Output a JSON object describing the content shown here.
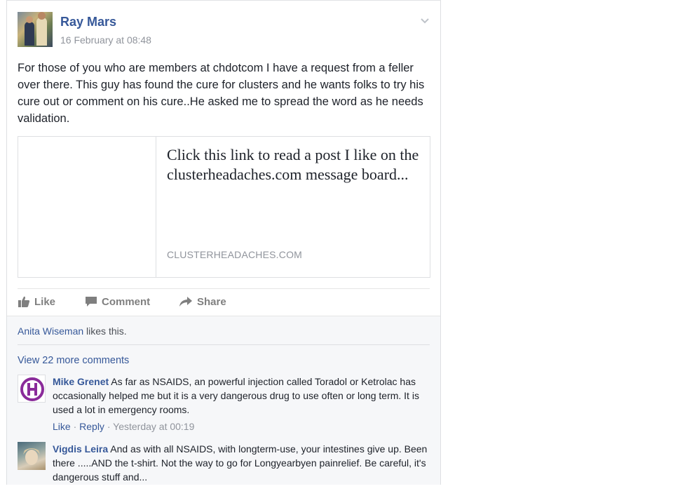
{
  "post": {
    "author": "Ray Mars",
    "timestamp": "16 February at 08:48",
    "text": "For those of you who are members at chdotcom I have a request from a feller over there. This guy has found the cure for clusters and he wants folks to try his cure out or comment on his cure..He asked me to spread the word as he needs validation.",
    "link": {
      "title": "Click this link to read a post I like on the clusterheadaches.com message board...",
      "domain": "CLUSTERHEADACHES.COM"
    },
    "actions": {
      "like": "Like",
      "comment": "Comment",
      "share": "Share"
    },
    "icons": {
      "menu": "chevron-down-icon",
      "like": "thumbs-up-icon",
      "comment": "speech-bubble-icon",
      "share": "share-arrow-icon"
    }
  },
  "likes": {
    "liker": "Anita Wiseman",
    "suffix": " likes this."
  },
  "comments_section": {
    "view_more": "View 22 more comments",
    "comments": [
      {
        "author": "Mike Grenet",
        "text": "As far as NSAIDS, an powerful injection called Toradol or Ketrolac has occasionally helped me but it is a very dangerous drug to use often or long term. It is used a lot in emergency rooms.",
        "like": "Like",
        "reply": "Reply",
        "time": "Yesterday at 00:19"
      },
      {
        "author": "Vigdis Leira",
        "text": "And as with all NSAIDS, with longterm-use, your intestines give up. Been there .....AND the t-shirt. Not the way to go for Longyearbyen painrelief. Be careful, it's dangerous stuff and..."
      }
    ]
  },
  "colors": {
    "link_blue": "#365899",
    "meta_gray": "#90949c",
    "action_gray": "#7f7f7f",
    "comment_bg": "#f6f7f9",
    "mike_avatar_purple": "#8a2b9a"
  }
}
